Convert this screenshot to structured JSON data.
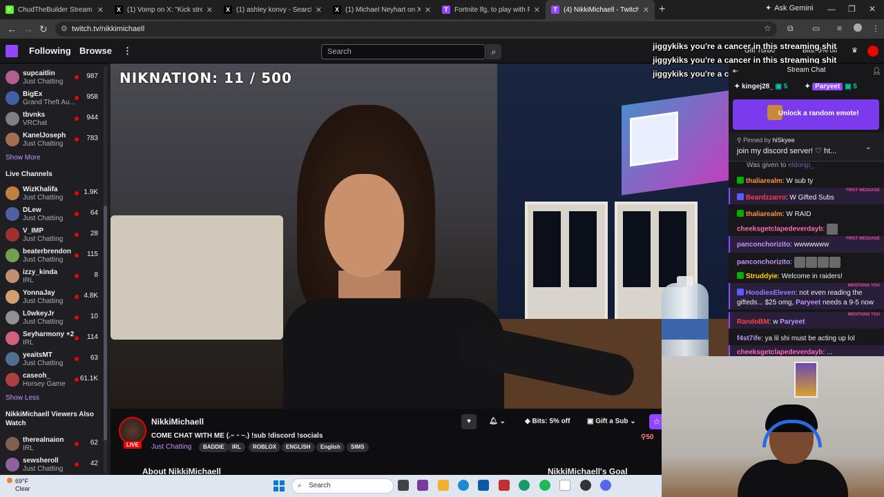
{
  "browser": {
    "tabs": [
      {
        "title": "ChudTheBuilder Stream - Watc",
        "fav": "K",
        "fav_color": "#53fc18",
        "active": false
      },
      {
        "title": "(1) Vomp on X: \"Kick streamer C",
        "fav": "X",
        "fav_color": "#000000",
        "active": false
      },
      {
        "title": "(1) ashley konvy - Search / X",
        "fav": "X",
        "fav_color": "#000000",
        "active": false
      },
      {
        "title": "(1) Michael Neyhart on X: \"Don",
        "fav": "X",
        "fav_color": "#000000",
        "active": false
      },
      {
        "title": "Fortnite lfg, to play with Fortnit",
        "fav": "T",
        "fav_color": "#9147ff",
        "active": false
      },
      {
        "title": "(4) NikkiMichaell - Twitch",
        "fav": "T",
        "fav_color": "#9147ff",
        "active": true
      }
    ],
    "ask_gemini": "Ask Gemini",
    "url": "twitch.tv/nikkimichaell"
  },
  "twitch_nav": {
    "following": "Following",
    "browse": "Browse",
    "search_placeholder": "Search"
  },
  "sidebar": {
    "followed": [
      {
        "name": "supcaitlin",
        "category": "Just Chatting",
        "viewers": "987",
        "color": "#b06090"
      },
      {
        "name": "BigEx",
        "category": "Grand Theft Au...",
        "viewers": "958",
        "color": "#4060a0"
      },
      {
        "name": "tbvnks",
        "category": "VRChat",
        "viewers": "944",
        "color": "#808080"
      },
      {
        "name": "KanelJoseph",
        "category": "Just Chatting",
        "viewers": "783",
        "color": "#a07050"
      }
    ],
    "show_more": "Show More",
    "live_heading": "Live Channels",
    "live": [
      {
        "name": "WizKhalifa",
        "category": "Just Chatting",
        "viewers": "1.9K",
        "color": "#c08040"
      },
      {
        "name": "DLew",
        "category": "Just Chatting",
        "viewers": "64",
        "color": "#5060a0"
      },
      {
        "name": "V_IMP",
        "category": "Just Chatting",
        "viewers": "28",
        "color": "#a03030"
      },
      {
        "name": "beaterbrendon",
        "category": "Just Chatting",
        "viewers": "115",
        "color": "#70a050"
      },
      {
        "name": "izzy_kinda",
        "category": "IRL",
        "viewers": "8",
        "color": "#c09070"
      },
      {
        "name": "YonnaJay",
        "category": "Just Chatting",
        "viewers": "4.8K",
        "color": "#d0a070"
      },
      {
        "name": "L0wkeyJr",
        "category": "Just Chatting",
        "viewers": "10",
        "color": "#909090"
      },
      {
        "name": "Seyharmony +2",
        "category": "IRL",
        "viewers": "114",
        "color": "#d06080"
      },
      {
        "name": "yeaitsMT",
        "category": "Just Chatting",
        "viewers": "63",
        "color": "#507090"
      },
      {
        "name": "caseoh_",
        "category": "Horsey Game",
        "viewers": "61.1K",
        "color": "#b04040"
      }
    ],
    "show_less": "Show Less",
    "also_watch_heading_1": "NikkiMichaell Viewers Also",
    "also_watch_heading_2": "Watch",
    "also_watch": [
      {
        "name": "therealnaion",
        "category": "IRL",
        "viewers": "62",
        "color": "#806050"
      },
      {
        "name": "sewsheroll",
        "category": "Just Chatting",
        "viewers": "42",
        "color": "#9060a0"
      }
    ]
  },
  "video": {
    "overlay_goal": "NIKNATION: 11 / 500"
  },
  "stream_info": {
    "streamer": "NikkiMichaell",
    "live_badge": "LIVE",
    "title": "COME CHAT WITH ME (.~ ᵕ ~.) !sub !discord !socials",
    "game": "Just Chatting",
    "tags": [
      "BADDIE",
      "IRL",
      "ROBLOX",
      "ENGLISH",
      "English",
      "SIMS"
    ],
    "bits_label": "Bits: 5% off",
    "gift_label": "Gift a Sub",
    "viewer_count": "50",
    "about": "About NikkiMichaell",
    "goal": "NikkiMichaell's Goal"
  },
  "top_right": {
    "gift_turbo": "Gift Turbo",
    "bits": "Bits: 5% off"
  },
  "floating_chat": [
    {
      "user": "jiggykiks",
      "text": "you're a cancer in this streaming shit"
    },
    {
      "user": "jiggykiks",
      "text": "you're a cancer in this streaming shit"
    },
    {
      "user": "jiggykiks",
      "text": "you're a cancer in this streaming shit"
    }
  ],
  "chat": {
    "header": "Stream Chat",
    "top_gifters": [
      {
        "name": "kingej28_",
        "count": "5"
      },
      {
        "name": "Paryeet",
        "count": "5"
      }
    ],
    "unlock": "Unlock a random emote!",
    "pinned_by_label": "Pinned by",
    "pinned_by_user": "hiSkyee",
    "pinned_text": "join my discord server! ♡ ht...",
    "gifted_partial": "Was given to",
    "gifted_partial_user": "eldonjp_",
    "first_message_label": "FIRST MESSAGE",
    "mentions_label": "MENTIONS YOU",
    "messages": [
      {
        "user": "thaliarealm",
        "color": "#ff8c40",
        "text": ": W sub ty"
      },
      {
        "user": "Beardzzarro",
        "color": "#ff4040",
        "text": ": W Gifted Subs"
      },
      {
        "user": "thaliarealm",
        "color": "#ff8c40",
        "text": ": W RAID"
      },
      {
        "user": "cheeksgetclapedeverdayb",
        "color": "#ff69b4",
        "text": ":"
      },
      {
        "user": "panconchorizito",
        "color": "#bf94ff",
        "text": ": wwwwwww"
      },
      {
        "user": "panconchorizito",
        "color": "#bf94ff",
        "text": ":"
      },
      {
        "user": "Struddyie",
        "color": "#ffd400",
        "text": ": Welcome in raiders!"
      },
      {
        "user": "HoodiesEleven",
        "color": "#9a7cff",
        "text": ": not even reading the gifteds... $25 omg,"
      },
      {
        "user": "Paryeet",
        "color": "#bf94ff",
        "text": "needs a 9-5 now"
      },
      {
        "user": "RandoBM",
        "color": "#ff4040",
        "text": ": w"
      },
      {
        "user": "Paryeet",
        "color": "#bf94ff",
        "text": ""
      },
      {
        "user": "f4st7ife",
        "color": "#bf94ff",
        "text": ": ya lil shi must be acting up lol"
      },
      {
        "user": "cheeksgetclapedeverdayb",
        "color": "#ff69b4",
        "text": ": ..."
      }
    ]
  },
  "taskbar": {
    "temp": "69°F",
    "weather": "Clear",
    "search": "Search"
  }
}
